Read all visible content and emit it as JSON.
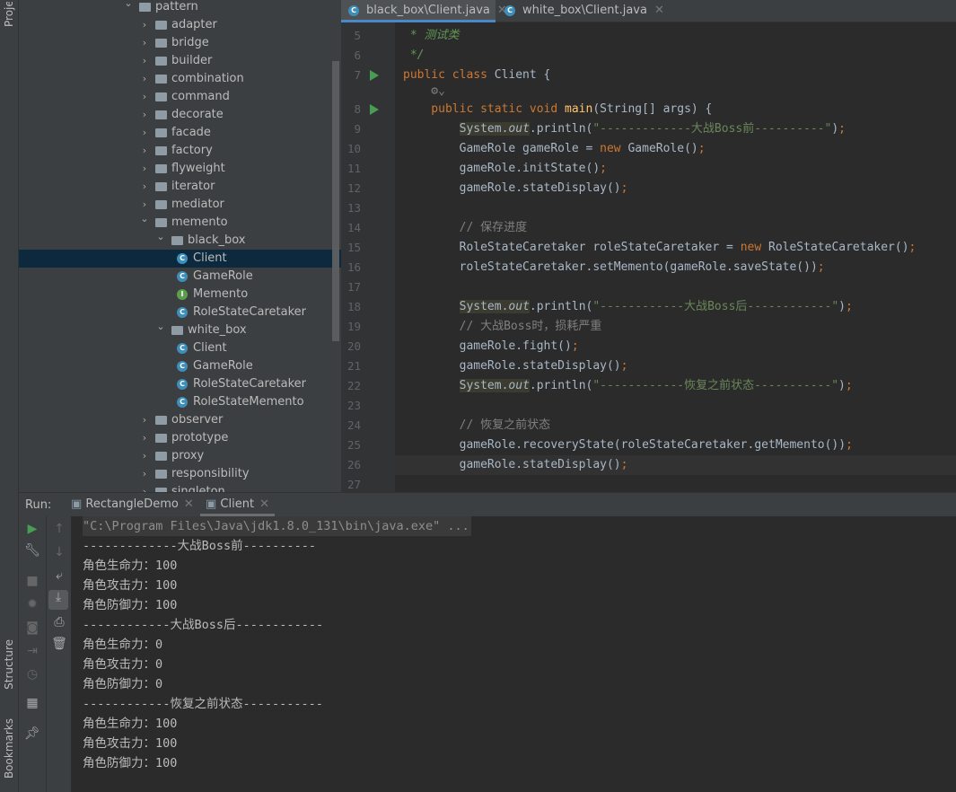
{
  "side_strip": {
    "project_label": "Project",
    "structure_label": "Structure",
    "bookmarks_label": "Bookmarks"
  },
  "tree": [
    {
      "label": "pattern",
      "type": "folder",
      "depth": 0,
      "expanded": true
    },
    {
      "label": "adapter",
      "type": "folder",
      "depth": 1,
      "expanded": false
    },
    {
      "label": "bridge",
      "type": "folder",
      "depth": 1,
      "expanded": false
    },
    {
      "label": "builder",
      "type": "folder",
      "depth": 1,
      "expanded": false
    },
    {
      "label": "combination",
      "type": "folder",
      "depth": 1,
      "expanded": false
    },
    {
      "label": "command",
      "type": "folder",
      "depth": 1,
      "expanded": false
    },
    {
      "label": "decorate",
      "type": "folder",
      "depth": 1,
      "expanded": false
    },
    {
      "label": "facade",
      "type": "folder",
      "depth": 1,
      "expanded": false
    },
    {
      "label": "factory",
      "type": "folder",
      "depth": 1,
      "expanded": false
    },
    {
      "label": "flyweight",
      "type": "folder",
      "depth": 1,
      "expanded": false
    },
    {
      "label": "iterator",
      "type": "folder",
      "depth": 1,
      "expanded": false
    },
    {
      "label": "mediator",
      "type": "folder",
      "depth": 1,
      "expanded": false
    },
    {
      "label": "memento",
      "type": "folder",
      "depth": 1,
      "expanded": true
    },
    {
      "label": "black_box",
      "type": "folder",
      "depth": 2,
      "expanded": true
    },
    {
      "label": "Client",
      "type": "class",
      "depth": 3,
      "selected": true
    },
    {
      "label": "GameRole",
      "type": "class",
      "depth": 3
    },
    {
      "label": "Memento",
      "type": "interface",
      "depth": 3
    },
    {
      "label": "RoleStateCaretaker",
      "type": "class",
      "depth": 3
    },
    {
      "label": "white_box",
      "type": "folder",
      "depth": 2,
      "expanded": true
    },
    {
      "label": "Client",
      "type": "class",
      "depth": 3
    },
    {
      "label": "GameRole",
      "type": "class",
      "depth": 3
    },
    {
      "label": "RoleStateCaretaker",
      "type": "class",
      "depth": 3
    },
    {
      "label": "RoleStateMemento",
      "type": "class",
      "depth": 3
    },
    {
      "label": "observer",
      "type": "folder",
      "depth": 1,
      "expanded": false
    },
    {
      "label": "prototype",
      "type": "folder",
      "depth": 1,
      "expanded": false
    },
    {
      "label": "proxy",
      "type": "folder",
      "depth": 1,
      "expanded": false
    },
    {
      "label": "responsibility",
      "type": "folder",
      "depth": 1,
      "expanded": false
    },
    {
      "label": "singleton",
      "type": "folder",
      "depth": 1,
      "expanded": false
    }
  ],
  "editor_tabs": [
    {
      "label": "black_box\\Client.java",
      "active": true
    },
    {
      "label": "white_box\\Client.java",
      "active": false
    }
  ],
  "code_lines": [
    {
      "n": "5",
      "tokens": [
        [
          " * ",
          "doc"
        ],
        [
          "测试类",
          "doc"
        ]
      ]
    },
    {
      "n": "6",
      "tokens": [
        [
          " */",
          "doc"
        ]
      ]
    },
    {
      "n": "7",
      "run": true,
      "tokens": [
        [
          "public class ",
          "kw"
        ],
        [
          "Client {",
          ""
        ]
      ]
    },
    {
      "n": "",
      "tokens": [
        [
          "    ⚙⌄",
          "cm"
        ]
      ]
    },
    {
      "n": "8",
      "run": true,
      "tokens": [
        [
          "    public static void ",
          "kw"
        ],
        [
          "main",
          "fn"
        ],
        [
          "(String[] args) {",
          ""
        ]
      ]
    },
    {
      "n": "9",
      "tokens": [
        [
          "        ",
          ""
        ],
        [
          "System.",
          "hl"
        ],
        [
          "out",
          "st hl"
        ],
        [
          ".println(",
          ""
        ],
        [
          "\"-------------大战Boss前----------\"",
          "str"
        ],
        [
          ")",
          ""
        ],
        [
          ";",
          "kw"
        ]
      ]
    },
    {
      "n": "10",
      "tokens": [
        [
          "        GameRole gameRole = ",
          ""
        ],
        [
          "new ",
          "kw"
        ],
        [
          "GameRole()",
          ""
        ],
        [
          ";",
          "kw"
        ]
      ]
    },
    {
      "n": "11",
      "tokens": [
        [
          "        gameRole.initState()",
          ""
        ],
        [
          ";",
          "kw"
        ]
      ]
    },
    {
      "n": "12",
      "tokens": [
        [
          "        gameRole.stateDisplay()",
          ""
        ],
        [
          ";",
          "kw"
        ]
      ]
    },
    {
      "n": "13",
      "tokens": []
    },
    {
      "n": "14",
      "tokens": [
        [
          "        // 保存进度",
          "cm"
        ]
      ]
    },
    {
      "n": "15",
      "tokens": [
        [
          "        RoleStateCaretaker roleStateCaretaker = ",
          ""
        ],
        [
          "new ",
          "kw"
        ],
        [
          "RoleStateCaretaker()",
          ""
        ],
        [
          ";",
          "kw"
        ]
      ]
    },
    {
      "n": "16",
      "tokens": [
        [
          "        roleStateCaretaker.setMemento(gameRole.saveState())",
          ""
        ],
        [
          ";",
          "kw"
        ]
      ]
    },
    {
      "n": "17",
      "tokens": []
    },
    {
      "n": "18",
      "tokens": [
        [
          "        ",
          ""
        ],
        [
          "System.",
          "hl"
        ],
        [
          "out",
          "st hl"
        ],
        [
          ".println(",
          ""
        ],
        [
          "\"------------大战Boss后------------\"",
          "str"
        ],
        [
          ")",
          ""
        ],
        [
          ";",
          "kw"
        ]
      ]
    },
    {
      "n": "19",
      "tokens": [
        [
          "        // 大战Boss时，损耗严重",
          "cm"
        ]
      ]
    },
    {
      "n": "20",
      "tokens": [
        [
          "        gameRole.fight()",
          ""
        ],
        [
          ";",
          "kw"
        ]
      ]
    },
    {
      "n": "21",
      "tokens": [
        [
          "        gameRole.stateDisplay()",
          ""
        ],
        [
          ";",
          "kw"
        ]
      ]
    },
    {
      "n": "22",
      "tokens": [
        [
          "        ",
          ""
        ],
        [
          "System.",
          "hl"
        ],
        [
          "out",
          "st hl"
        ],
        [
          ".println(",
          ""
        ],
        [
          "\"------------恢复之前状态-----------\"",
          "str"
        ],
        [
          ")",
          ""
        ],
        [
          ";",
          "kw"
        ]
      ]
    },
    {
      "n": "23",
      "tokens": []
    },
    {
      "n": "24",
      "tokens": [
        [
          "        // 恢复之前状态",
          "cm"
        ]
      ]
    },
    {
      "n": "25",
      "tokens": [
        [
          "        gameRole.recoveryState(roleStateCaretaker.getMemento())",
          ""
        ],
        [
          ";",
          "kw"
        ]
      ]
    },
    {
      "n": "26",
      "current": true,
      "tokens": [
        [
          "        gameRole.stateDisplay()",
          ""
        ],
        [
          ";",
          "kw"
        ]
      ]
    },
    {
      "n": "27",
      "tokens": []
    }
  ],
  "run_panel": {
    "label": "Run:",
    "tabs": [
      {
        "label": "RectangleDemo",
        "active": false
      },
      {
        "label": "Client",
        "active": true
      }
    ],
    "console": [
      "\"C:\\Program Files\\Java\\jdk1.8.0_131\\bin\\java.exe\" ...",
      "-------------大战Boss前----------",
      "角色生命力：100",
      "角色攻击力：100",
      "角色防御力：100",
      "------------大战Boss后------------",
      "角色生命力：0",
      "角色攻击力：0",
      "角色防御力：0",
      "------------恢复之前状态-----------",
      "角色生命力：100",
      "角色攻击力：100",
      "角色防御力：100"
    ]
  },
  "colors": {
    "accent": "#4a88c7",
    "keyword": "#cc7832",
    "string": "#6a8759",
    "selection": "#0d293e",
    "run_green": "#499c54"
  }
}
